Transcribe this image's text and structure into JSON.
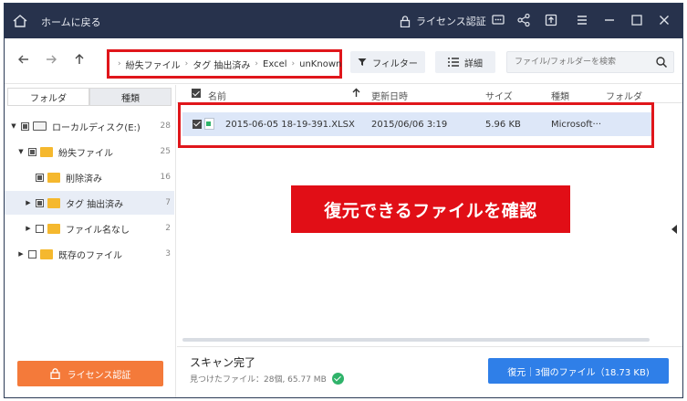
{
  "titlebar": {
    "back_label": "ホームに戻る",
    "license_label": "ライセンス認証"
  },
  "toolbar": {
    "breadcrumb": [
      "紛失ファイル",
      "タグ 抽出済み",
      "Excel",
      "unKnown"
    ],
    "filter_label": "フィルター",
    "detail_label": "詳細",
    "search_placeholder": "ファイル/フォルダーを検索"
  },
  "sidebar": {
    "tabs": [
      "フォルダ",
      "種類"
    ],
    "tree": [
      {
        "label": "ローカルディスク(E:)",
        "count": "28"
      },
      {
        "label": "紛失ファイル",
        "count": "25"
      },
      {
        "label": "削除済み",
        "count": "16"
      },
      {
        "label": "タグ 抽出済み",
        "count": "7"
      },
      {
        "label": "ファイル名なし",
        "count": "2"
      },
      {
        "label": "既存のファイル",
        "count": "3"
      }
    ],
    "license_button": "ライセンス認証"
  },
  "list": {
    "columns": [
      "名前",
      "更新日時",
      "サイズ",
      "種類",
      "フォルダ"
    ],
    "rows": [
      {
        "name": "2015-06-05 18-19-391.XLSX",
        "modified": "2015/06/06 3:19",
        "size": "5.96 KB",
        "type": "Microsoft···"
      }
    ]
  },
  "callout": "復元できるファイルを確認",
  "footer": {
    "scan_title": "スキャン完了",
    "scan_summary": "見つけたファイル：28個, 65.77 MB",
    "recover_button": "復元｜3個のファイル（18.73 KB)"
  },
  "colors": {
    "titlebar": "#27324c",
    "annotation_red": "#e0161b",
    "recover_blue": "#2f7fe8",
    "license_orange": "#f47a3a",
    "folder_yellow": "#f5b82e"
  }
}
